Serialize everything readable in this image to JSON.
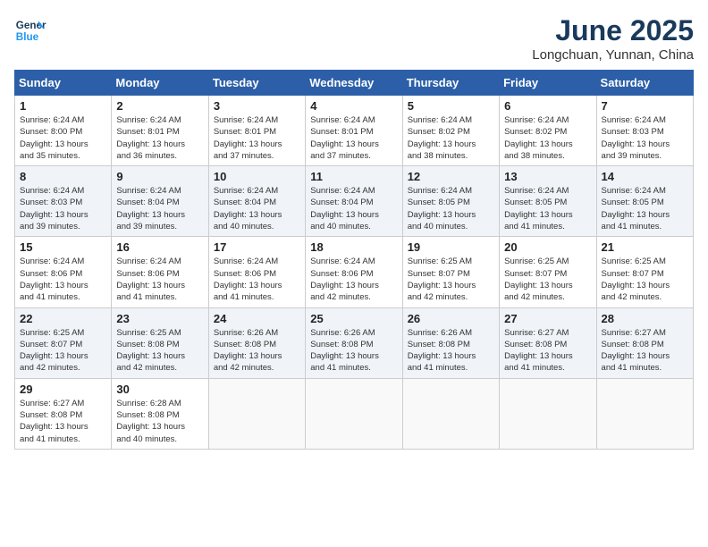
{
  "header": {
    "logo_line1": "General",
    "logo_line2": "Blue",
    "month": "June 2025",
    "location": "Longchuan, Yunnan, China"
  },
  "weekdays": [
    "Sunday",
    "Monday",
    "Tuesday",
    "Wednesday",
    "Thursday",
    "Friday",
    "Saturday"
  ],
  "weeks": [
    [
      {
        "day": "1",
        "info": "Sunrise: 6:24 AM\nSunset: 8:00 PM\nDaylight: 13 hours\nand 35 minutes."
      },
      {
        "day": "2",
        "info": "Sunrise: 6:24 AM\nSunset: 8:01 PM\nDaylight: 13 hours\nand 36 minutes."
      },
      {
        "day": "3",
        "info": "Sunrise: 6:24 AM\nSunset: 8:01 PM\nDaylight: 13 hours\nand 37 minutes."
      },
      {
        "day": "4",
        "info": "Sunrise: 6:24 AM\nSunset: 8:01 PM\nDaylight: 13 hours\nand 37 minutes."
      },
      {
        "day": "5",
        "info": "Sunrise: 6:24 AM\nSunset: 8:02 PM\nDaylight: 13 hours\nand 38 minutes."
      },
      {
        "day": "6",
        "info": "Sunrise: 6:24 AM\nSunset: 8:02 PM\nDaylight: 13 hours\nand 38 minutes."
      },
      {
        "day": "7",
        "info": "Sunrise: 6:24 AM\nSunset: 8:03 PM\nDaylight: 13 hours\nand 39 minutes."
      }
    ],
    [
      {
        "day": "8",
        "info": "Sunrise: 6:24 AM\nSunset: 8:03 PM\nDaylight: 13 hours\nand 39 minutes."
      },
      {
        "day": "9",
        "info": "Sunrise: 6:24 AM\nSunset: 8:04 PM\nDaylight: 13 hours\nand 39 minutes."
      },
      {
        "day": "10",
        "info": "Sunrise: 6:24 AM\nSunset: 8:04 PM\nDaylight: 13 hours\nand 40 minutes."
      },
      {
        "day": "11",
        "info": "Sunrise: 6:24 AM\nSunset: 8:04 PM\nDaylight: 13 hours\nand 40 minutes."
      },
      {
        "day": "12",
        "info": "Sunrise: 6:24 AM\nSunset: 8:05 PM\nDaylight: 13 hours\nand 40 minutes."
      },
      {
        "day": "13",
        "info": "Sunrise: 6:24 AM\nSunset: 8:05 PM\nDaylight: 13 hours\nand 41 minutes."
      },
      {
        "day": "14",
        "info": "Sunrise: 6:24 AM\nSunset: 8:05 PM\nDaylight: 13 hours\nand 41 minutes."
      }
    ],
    [
      {
        "day": "15",
        "info": "Sunrise: 6:24 AM\nSunset: 8:06 PM\nDaylight: 13 hours\nand 41 minutes."
      },
      {
        "day": "16",
        "info": "Sunrise: 6:24 AM\nSunset: 8:06 PM\nDaylight: 13 hours\nand 41 minutes."
      },
      {
        "day": "17",
        "info": "Sunrise: 6:24 AM\nSunset: 8:06 PM\nDaylight: 13 hours\nand 41 minutes."
      },
      {
        "day": "18",
        "info": "Sunrise: 6:24 AM\nSunset: 8:06 PM\nDaylight: 13 hours\nand 42 minutes."
      },
      {
        "day": "19",
        "info": "Sunrise: 6:25 AM\nSunset: 8:07 PM\nDaylight: 13 hours\nand 42 minutes."
      },
      {
        "day": "20",
        "info": "Sunrise: 6:25 AM\nSunset: 8:07 PM\nDaylight: 13 hours\nand 42 minutes."
      },
      {
        "day": "21",
        "info": "Sunrise: 6:25 AM\nSunset: 8:07 PM\nDaylight: 13 hours\nand 42 minutes."
      }
    ],
    [
      {
        "day": "22",
        "info": "Sunrise: 6:25 AM\nSunset: 8:07 PM\nDaylight: 13 hours\nand 42 minutes."
      },
      {
        "day": "23",
        "info": "Sunrise: 6:25 AM\nSunset: 8:08 PM\nDaylight: 13 hours\nand 42 minutes."
      },
      {
        "day": "24",
        "info": "Sunrise: 6:26 AM\nSunset: 8:08 PM\nDaylight: 13 hours\nand 42 minutes."
      },
      {
        "day": "25",
        "info": "Sunrise: 6:26 AM\nSunset: 8:08 PM\nDaylight: 13 hours\nand 41 minutes."
      },
      {
        "day": "26",
        "info": "Sunrise: 6:26 AM\nSunset: 8:08 PM\nDaylight: 13 hours\nand 41 minutes."
      },
      {
        "day": "27",
        "info": "Sunrise: 6:27 AM\nSunset: 8:08 PM\nDaylight: 13 hours\nand 41 minutes."
      },
      {
        "day": "28",
        "info": "Sunrise: 6:27 AM\nSunset: 8:08 PM\nDaylight: 13 hours\nand 41 minutes."
      }
    ],
    [
      {
        "day": "29",
        "info": "Sunrise: 6:27 AM\nSunset: 8:08 PM\nDaylight: 13 hours\nand 41 minutes."
      },
      {
        "day": "30",
        "info": "Sunrise: 6:28 AM\nSunset: 8:08 PM\nDaylight: 13 hours\nand 40 minutes."
      },
      null,
      null,
      null,
      null,
      null
    ]
  ]
}
